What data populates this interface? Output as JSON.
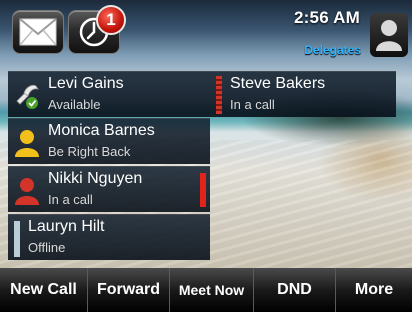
{
  "header": {
    "time": "2:56 AM",
    "delegates_label": "Delegates",
    "missed_calls_count": "1"
  },
  "buddies": [
    {
      "name": "Levi Gains",
      "status": "Available",
      "status_color": "#4aa02c"
    },
    {
      "name": "Steve Bakers",
      "status": "In a call",
      "status_color": "#d2342a"
    },
    {
      "name": "Monica Barnes",
      "status": "Be Right Back",
      "status_color": "#f2c01a"
    },
    {
      "name": "Nikki Nguyen",
      "status": "In a call",
      "status_color": "#d2342a"
    },
    {
      "name": "Lauryn Hilt",
      "status": "Offline",
      "status_color": "#b9cdd6"
    }
  ],
  "softkeys": [
    "New Call",
    "Forward",
    "Meet Now",
    "DND",
    "More"
  ],
  "icons": {
    "mail": "envelope-icon",
    "call_history": "clock-icon",
    "user": "person-icon"
  },
  "colors": {
    "delegates_text": "#2fb3ff",
    "badge": "#c2130a"
  }
}
